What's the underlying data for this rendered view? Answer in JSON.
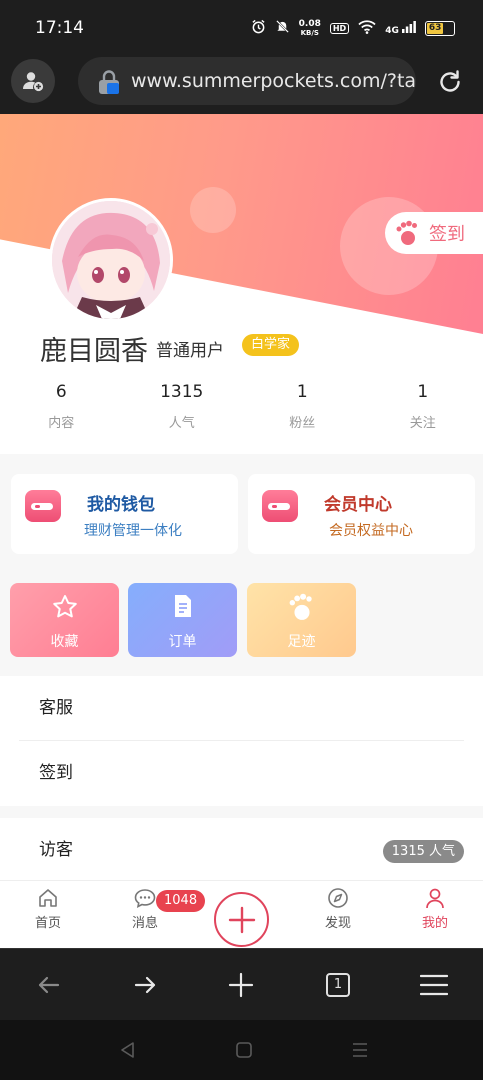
{
  "status_bar": {
    "time": "17:14",
    "speed_value": "0.08",
    "speed_unit": "KB/S",
    "hd": "HD",
    "network": "4G",
    "battery": "63"
  },
  "browser": {
    "url": "www.summerpockets.com/?task"
  },
  "profile": {
    "checkin_label": "签到",
    "username": "鹿目圆香",
    "user_group": "普通用户",
    "badge": "白学家",
    "stats": [
      {
        "value": "6",
        "label": "内容"
      },
      {
        "value": "1315",
        "label": "人气"
      },
      {
        "value": "1",
        "label": "粉丝"
      },
      {
        "value": "1",
        "label": "关注"
      }
    ]
  },
  "cards": {
    "wallet": {
      "title": "我的钱包",
      "subtitle": "理财管理一体化"
    },
    "vip": {
      "title": "会员中心",
      "subtitle": "会员权益中心"
    }
  },
  "tiles": [
    {
      "label": "收藏",
      "icon": "star-icon"
    },
    {
      "label": "订单",
      "icon": "document-icon"
    },
    {
      "label": "足迹",
      "icon": "footprint-icon"
    }
  ],
  "menu": {
    "service": "客服",
    "checkin": "签到",
    "visitors": "访客",
    "visitor_count": "1315 人气"
  },
  "tabbar": {
    "home": "首页",
    "messages": "消息",
    "message_badge": "1048",
    "discover": "发现",
    "me": "我的"
  },
  "browser_toolbar": {
    "tab_count": "1"
  },
  "colors": {
    "accent": "#e0445c",
    "badge": "#f4c21c",
    "wallet_title": "#1f5aa3",
    "vip_title": "#c0392b"
  }
}
